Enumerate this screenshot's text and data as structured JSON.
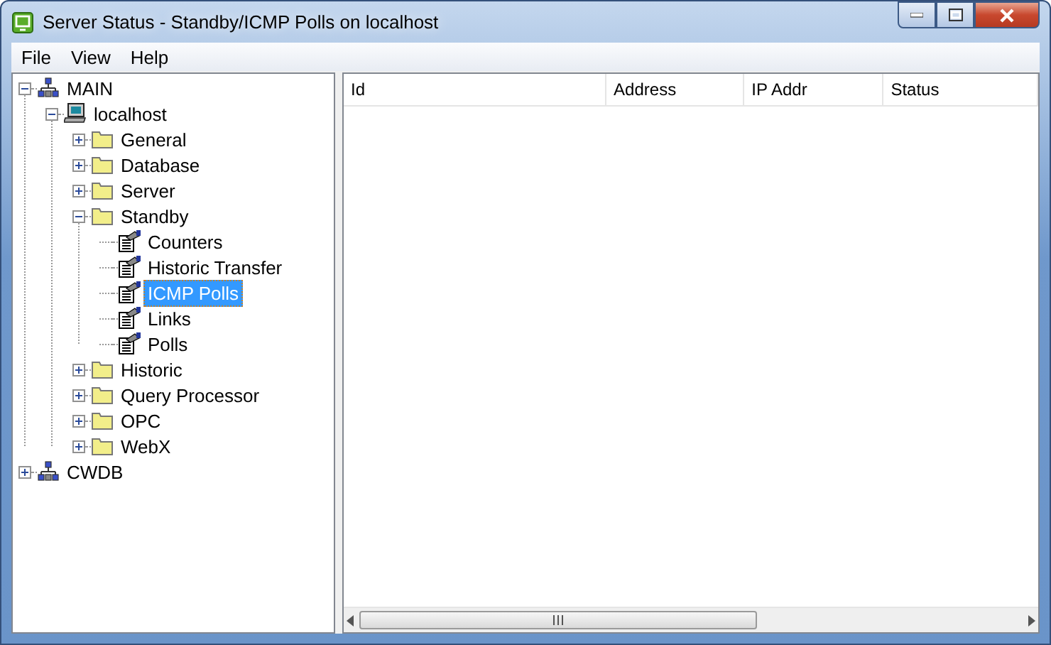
{
  "window": {
    "title": "Server Status - Standby/ICMP Polls on localhost"
  },
  "menu": [
    "File",
    "View",
    "Help"
  ],
  "tree": [
    {
      "label": "MAIN",
      "kind": "network",
      "expanded": true,
      "selected": false,
      "children": [
        {
          "label": "localhost",
          "kind": "computer",
          "expanded": true,
          "selected": false,
          "children": [
            {
              "label": "General",
              "kind": "folder",
              "expanded": false,
              "selected": false
            },
            {
              "label": "Database",
              "kind": "folder",
              "expanded": false,
              "selected": false
            },
            {
              "label": "Server",
              "kind": "folder",
              "expanded": false,
              "selected": false
            },
            {
              "label": "Standby",
              "kind": "folder",
              "expanded": true,
              "selected": false,
              "children": [
                {
                  "label": "Counters",
                  "kind": "page",
                  "selected": false
                },
                {
                  "label": "Historic Transfer",
                  "kind": "page",
                  "selected": false
                },
                {
                  "label": "ICMP Polls",
                  "kind": "page",
                  "selected": true
                },
                {
                  "label": "Links",
                  "kind": "page",
                  "selected": false
                },
                {
                  "label": "Polls",
                  "kind": "page",
                  "selected": false
                }
              ]
            },
            {
              "label": "Historic",
              "kind": "folder",
              "expanded": false,
              "selected": false
            },
            {
              "label": "Query Processor",
              "kind": "folder",
              "expanded": false,
              "selected": false
            },
            {
              "label": "OPC",
              "kind": "folder",
              "expanded": false,
              "selected": false
            },
            {
              "label": "WebX",
              "kind": "folder",
              "expanded": false,
              "selected": false
            }
          ]
        }
      ]
    },
    {
      "label": "CWDB",
      "kind": "network",
      "expanded": false,
      "selected": false
    }
  ],
  "table": {
    "columns": [
      "Id",
      "Address",
      "IP Addr",
      "Status"
    ]
  }
}
